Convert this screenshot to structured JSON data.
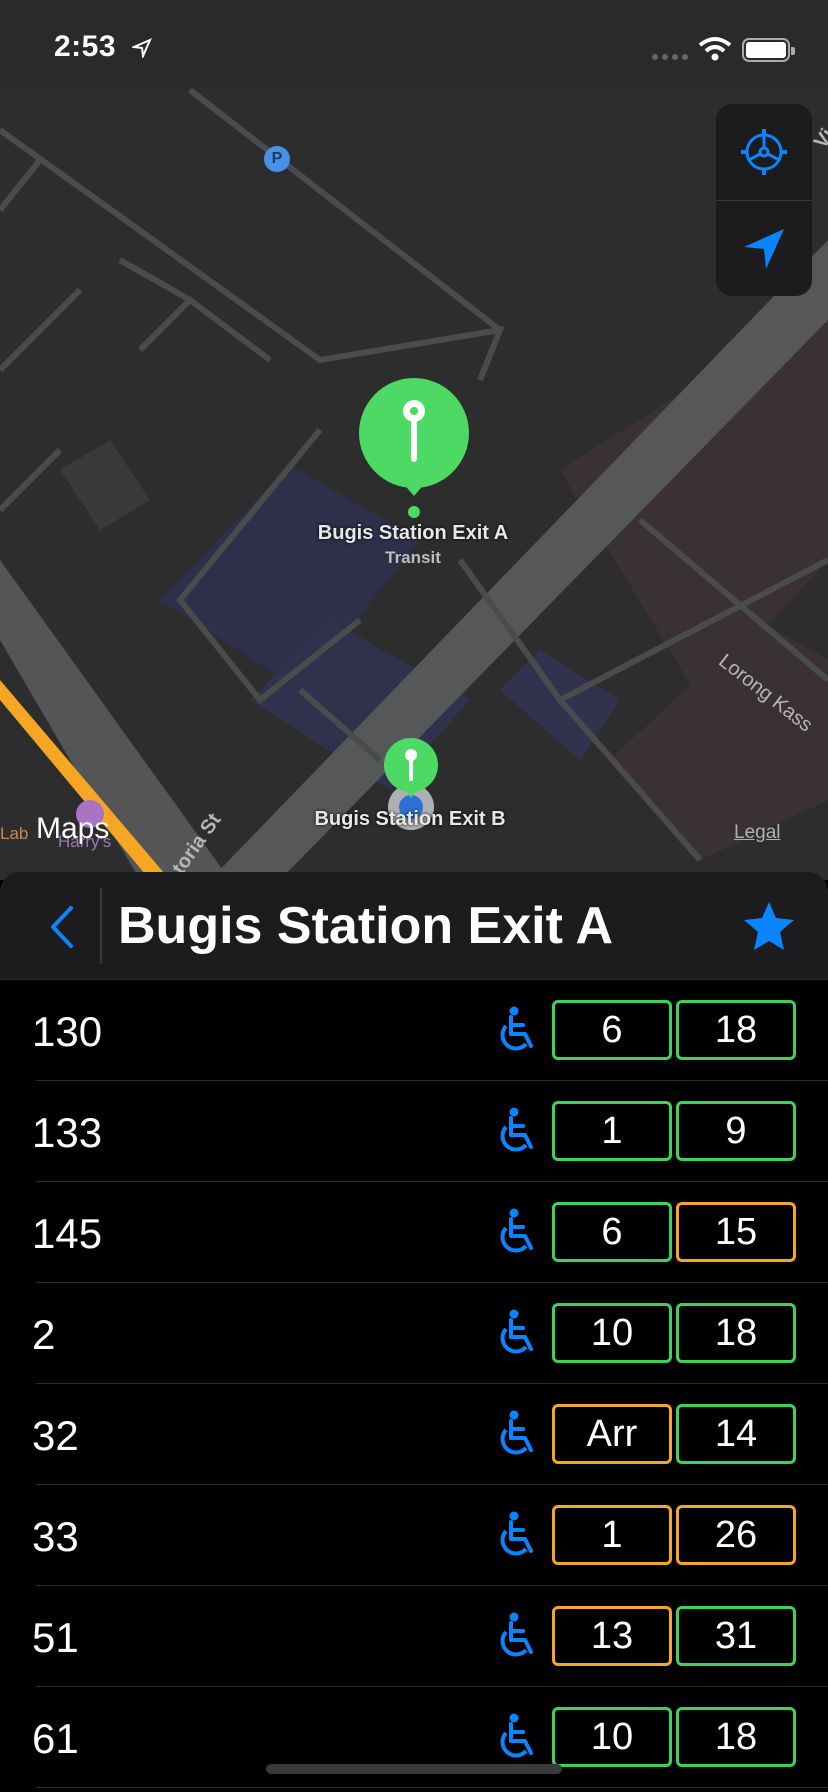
{
  "status_bar": {
    "time": "2:53"
  },
  "map": {
    "places": {
      "exit_a": {
        "title": "Bugis Station Exit A",
        "subtitle": "Transit"
      },
      "exit_b": {
        "title": "Bugis Station Exit B"
      },
      "parking": "P"
    },
    "streets": [
      "Lorong Kass",
      "toria St",
      "Vi"
    ],
    "pois": [
      "Lab",
      "Harry's"
    ],
    "attribution": "Maps",
    "legal": "Legal"
  },
  "header": {
    "title": "Bugis Station Exit A"
  },
  "services": [
    {
      "number": "130",
      "next": "6",
      "next_color": "green",
      "following": "18",
      "following_color": "green"
    },
    {
      "number": "133",
      "next": "1",
      "next_color": "green",
      "following": "9",
      "following_color": "green"
    },
    {
      "number": "145",
      "next": "6",
      "next_color": "green",
      "following": "15",
      "following_color": "orange"
    },
    {
      "number": "2",
      "next": "10",
      "next_color": "green",
      "following": "18",
      "following_color": "green"
    },
    {
      "number": "32",
      "next": "Arr",
      "next_color": "orange",
      "following": "14",
      "following_color": "green"
    },
    {
      "number": "33",
      "next": "1",
      "next_color": "orange",
      "following": "26",
      "following_color": "orange"
    },
    {
      "number": "51",
      "next": "13",
      "next_color": "orange",
      "following": "31",
      "following_color": "green"
    },
    {
      "number": "61",
      "next": "10",
      "next_color": "green",
      "following": "18",
      "following_color": "green"
    }
  ],
  "colors": {
    "accent": "#0a84ff",
    "green": "#3fd25a",
    "orange": "#f5a623",
    "pin": "#4cd964"
  },
  "icons": [
    "location-arrow-icon",
    "wifi-icon",
    "battery-icon",
    "steering-wheel-icon",
    "navigation-arrow-icon",
    "chevron-left-icon",
    "star-icon",
    "wheelchair-icon",
    "transit-pin-icon"
  ]
}
